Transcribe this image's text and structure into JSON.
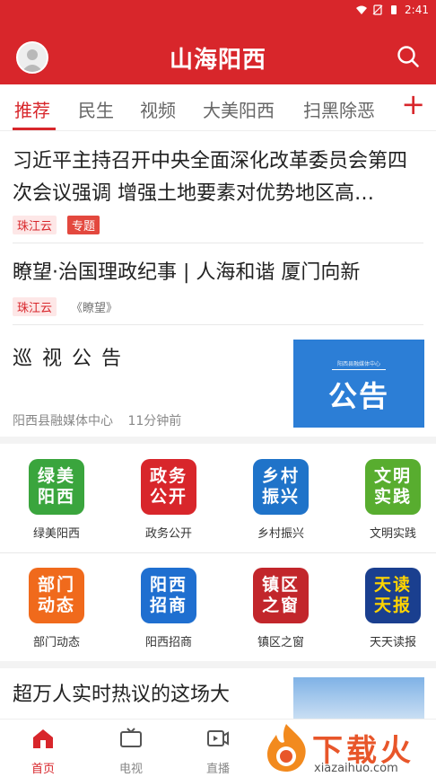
{
  "status_bar": {
    "time": "2:41"
  },
  "header": {
    "title": "山海阳西"
  },
  "tabs": [
    {
      "label": "推荐",
      "active": true
    },
    {
      "label": "民生"
    },
    {
      "label": "视频"
    },
    {
      "label": "大美阳西"
    },
    {
      "label": "扫黑除恶"
    }
  ],
  "tab_add": "+",
  "articles": [
    {
      "title": "习近平主持召开中央全面深化改革委员会第四次会议强调 增强土地要素对优势地区高…",
      "source": "珠江云",
      "tag": "专题"
    },
    {
      "title": "瞭望·治国理政纪事 | 人海和谐 厦门向新",
      "source": "珠江云",
      "magazine": "《瞭望》"
    },
    {
      "title": "巡 视 公 告",
      "source": "阳西县融媒体中心",
      "time": "11分钟前",
      "thumb_text": "公告",
      "thumb_caption": "阳西县融媒体中心"
    }
  ],
  "grid_row1": [
    {
      "label": "绿美阳西",
      "icon_text": [
        "绿美",
        "阳西"
      ],
      "color": "#3aa53d"
    },
    {
      "label": "政务公开",
      "icon_text": [
        "政务",
        "公开"
      ],
      "color": "#d8262b"
    },
    {
      "label": "乡村振兴",
      "icon_text": [
        "乡村",
        "振兴"
      ],
      "color": "#1f73c9"
    },
    {
      "label": "文明实践",
      "icon_text": [
        "文明",
        "实践"
      ],
      "color": "#58ad2f"
    }
  ],
  "grid_row2": [
    {
      "label": "部门动态",
      "icon_text": [
        "部门",
        "动态"
      ],
      "color": "#f06a1c"
    },
    {
      "label": "阳西招商",
      "icon_text": [
        "阳西",
        "招商"
      ],
      "color": "#1f6fd0"
    },
    {
      "label": "镇区之窗",
      "icon_text": [
        "镇区",
        "之窗"
      ],
      "color": "#c2262b"
    },
    {
      "label": "天天读报",
      "icon_text": [
        "天读",
        "天报"
      ],
      "color": "#1a3f8f"
    }
  ],
  "next_article": {
    "title": "超万人实时热议的这场大"
  },
  "bottom_nav": [
    {
      "label": "首页",
      "active": true
    },
    {
      "label": "电视"
    },
    {
      "label": "直播"
    }
  ],
  "watermark": {
    "text": "下载火",
    "url": "xiazaihuo.com"
  }
}
